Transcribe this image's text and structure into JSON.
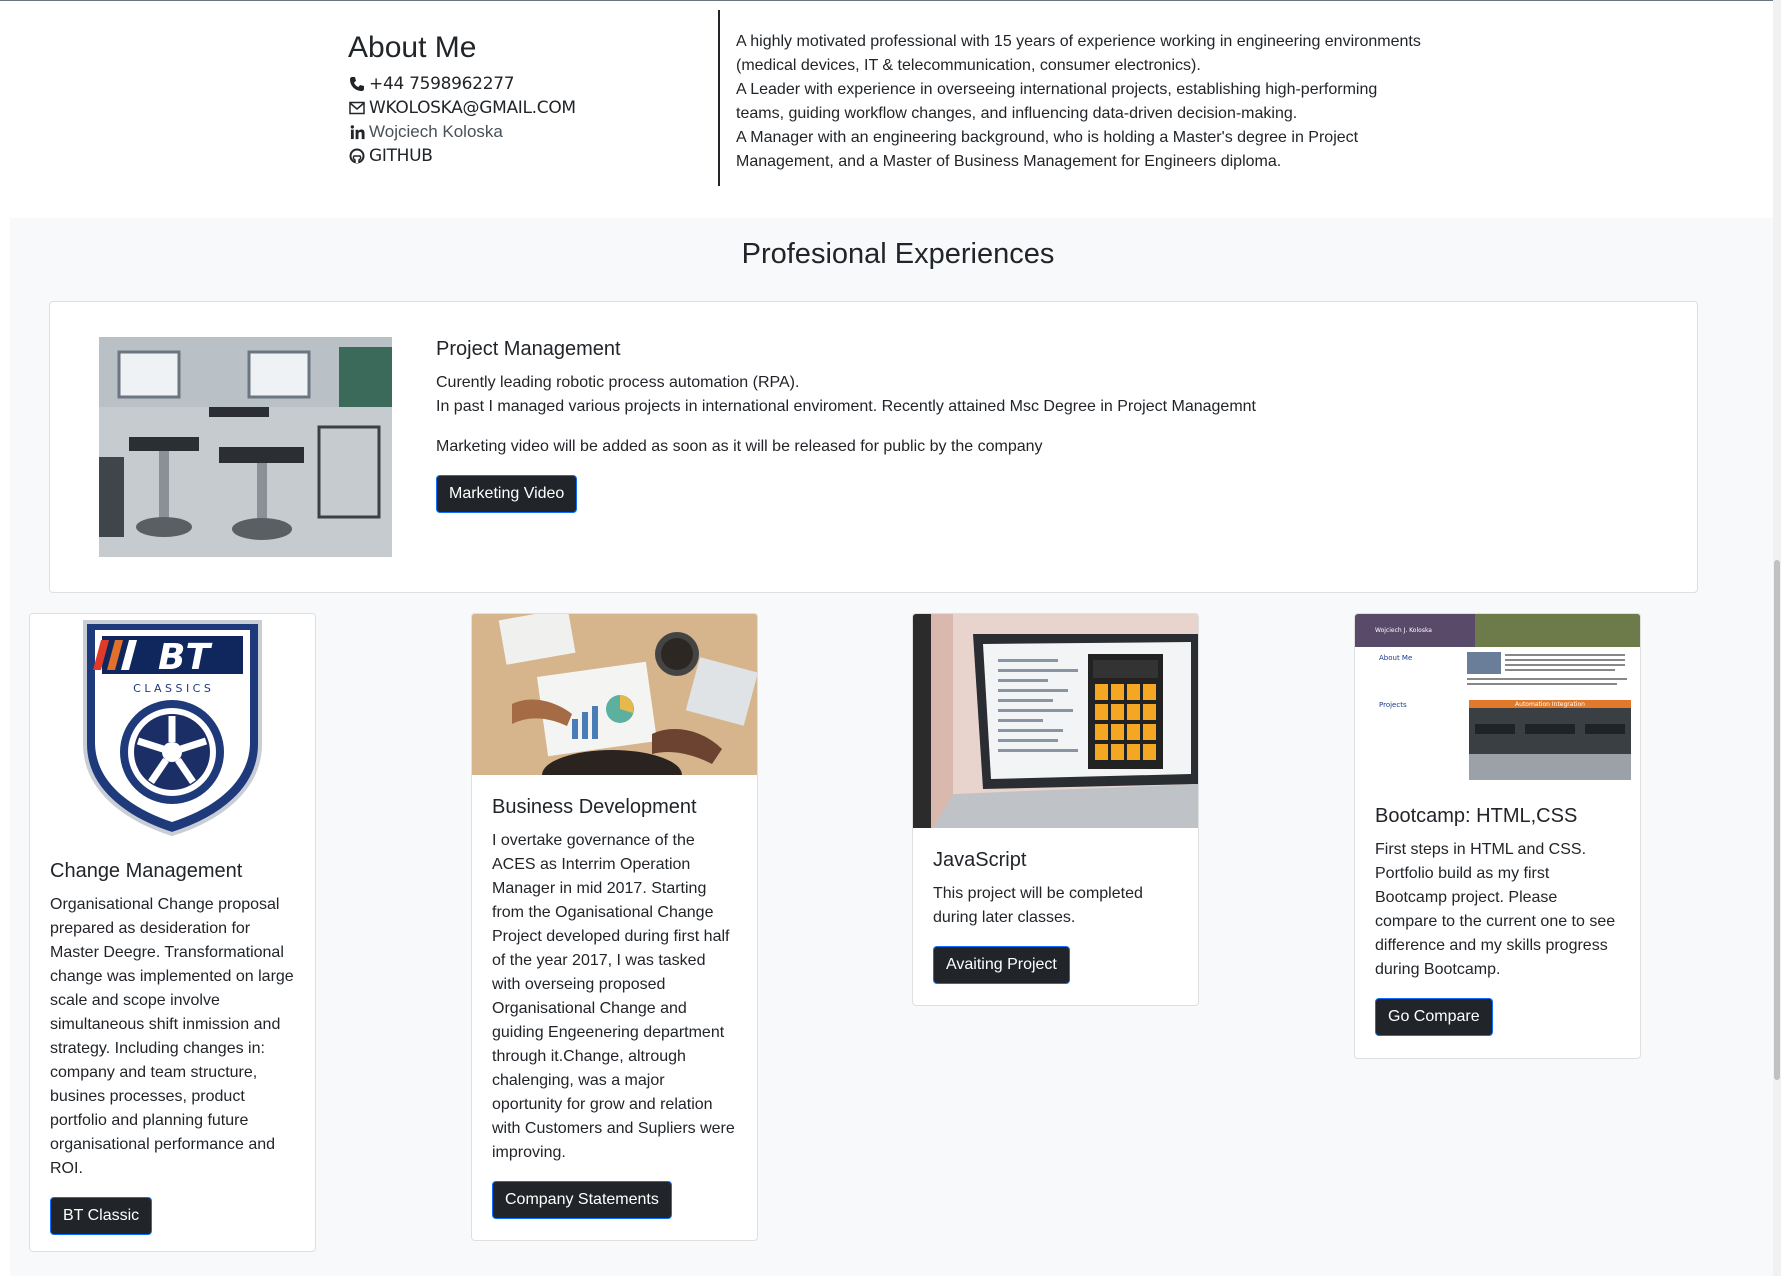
{
  "about": {
    "title": "About Me",
    "phone": "+44 7598962277",
    "email": "WKOLOSKA@GMAIL.COM",
    "linkedin": "Wojciech Koloska",
    "github": "GITHUB",
    "lines": [
      "A highly motivated professional with 15 years of experience working in engineering environments",
      "(medical devices, IT & telecommunication, consumer electronics).",
      "A Leader with experience in overseeing international projects, establishing high-performing",
      "teams, guiding workflow changes, and influencing data-driven decision-making.",
      "A Manager with an engineering background, who is holding a Master's degree in Project",
      "Management, and a Master of Business Management for Engineers diploma."
    ]
  },
  "experiences": {
    "title": "Profesional Experiences",
    "feature": {
      "title": "Project Management",
      "line1": "Curently leading robotic process automation (RPA).",
      "line2": "In past I managed various projects in international enviroment. Recently attained Msc Degree in Project Managemnt",
      "note": "Marketing video will be added as soon as it will be released for public by the company",
      "button": "Marketing Video"
    },
    "cards": [
      {
        "title": "Change Management",
        "text": "Organisational Change proposal prepared as desideration for Master Deegre. Transformational change was implemented on large scale and scope involve simultaneous shift inmission and strategy. Including changes in: company and team structure, busines processes, product portfolio and planning future organisational performance and ROI.",
        "button": "BT Classic",
        "logo_text": "BT",
        "logo_sub": "C L A S S I C S"
      },
      {
        "title": "Business Development",
        "text": "I overtake governance of the ACES as Interrim Operation Manager in mid 2017. Starting from the Oganisational Change Project developed during first half of the year 2017, I was tasked with overseing proposed Organisational Change and guiding Engeenering department through it.Change, altrough chalenging, was a major oportunity for grow and relation with Customers and Supliers were improving.",
        "button": "Company Statements"
      },
      {
        "title": "JavaScript",
        "text": "This project will be completed during later classes.",
        "button": "Avaiting Project"
      },
      {
        "title": "Bootcamp: HTML,CSS",
        "text": "First steps in HTML and CSS. Portfolio build as my first Bootcamp project. Please compare to the current one to see difference and my skills progress during Bootcamp.",
        "button": "Go Compare",
        "thumb_name": "Wojciech J. Koloska",
        "thumb_about": "About Me",
        "thumb_projects": "Projects",
        "thumb_banner": "Automation Integration"
      }
    ]
  },
  "colors": {
    "button_bg": "#212529",
    "button_border": "#0d6efd",
    "section_bg": "#f8f9fa"
  }
}
